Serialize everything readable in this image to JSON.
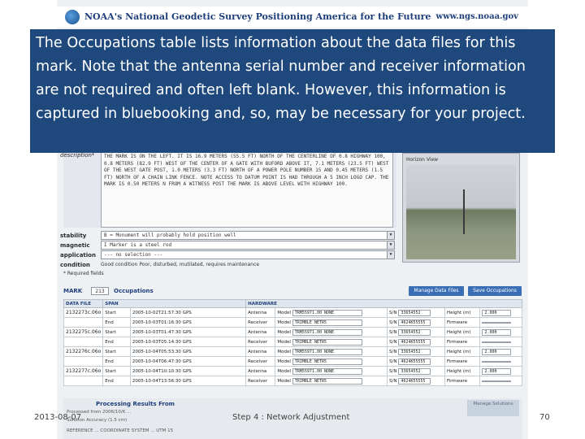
{
  "header": {
    "org_title": "NOAA's National Geodetic Survey Positioning America for the Future",
    "url": "www.ngs.noaa.gov"
  },
  "callout": {
    "text": "The Occupations table lists information about the data files for this mark. Note that the antenna serial number and receiver information are not required and often left blank. However, this information is captured in bluebooking and, so, may be necessary for your project."
  },
  "mark_form": {
    "description_label": "description*",
    "description_text": "THE MARK IS ON THE LEFT. IT IS 16.9 METERS (55.5 FT) NORTH OF THE CENTERLINE OF 0.8 HIGHWAY 100, 0.8 METERS (82.9 FT) WEST OF THE CENTER OF A GATE WITH BUFORD ABOVE IT, 7.1 METERS (23.5 FT) WEST OF THE WEST GATE POST, 1.0 METERS (3.3 FT) NORTH OF A POWER POLE NUMBER 15 AND 0.45 METERS (1.5 FT) NORTH OF A CHAIN LINK FENCE. NOTE ACCESS TO DATUM POINT IS HAD THROUGH A 5 INCH LOGO CAP. THE MARK IS 0.50 METERS N FROM A WITNESS POST THE MARK IS ABOVE LEVEL WITH HIGHWAY 100.",
    "horizon_view_label": "Horizon View",
    "stability_label": "stability",
    "stability_value": "B = Monument will probably hold position well",
    "magnetic_label": "magnetic",
    "magnetic_value": "I   Marker is a steel rod",
    "application_label": "application",
    "application_value": "--- no selection ---",
    "condition_label": "condition",
    "condition_value": "Good condition   Poor, disturbed, mutilated, requires maintenance",
    "required_note": "* Required fields"
  },
  "occupations": {
    "mark_label": "MARK",
    "mark_select": "213",
    "title": "Occupations",
    "manage_button": "Manage Data Files",
    "save_button": "Save Occupations",
    "columns": [
      "DATA FILE",
      "SPAN",
      "HARDWARE"
    ],
    "rows": [
      {
        "file": "2132273c.06o",
        "span_label": "Start",
        "span": "2005-10-02T21:57:30 GPS",
        "hw": "Antenna",
        "model": "TRM55971.00  NONE",
        "sn": "33654552",
        "field": "Height (m)",
        "fval": "2.000",
        "yellow": false
      },
      {
        "file": "",
        "span_label": "End",
        "span": "2005-10-03T01:16:30 GPS",
        "hw": "Receiver",
        "model": "TRIMBLE NETR5",
        "sn": "4624K55555",
        "field": "Firmware",
        "fval": "",
        "yellow": true
      },
      {
        "file": "2132275c.06o",
        "span_label": "Start",
        "span": "2005-10-03T01:47:30 GPS",
        "hw": "Antenna",
        "model": "TRM55971.00  NONE",
        "sn": "33654552",
        "field": "Height (m)",
        "fval": "2.000",
        "yellow": false
      },
      {
        "file": "",
        "span_label": "End",
        "span": "2005-10-03T05:14:30 GPS",
        "hw": "Receiver",
        "model": "TRIMBLE NETR5",
        "sn": "4624K55555",
        "field": "Firmware",
        "fval": "",
        "yellow": true
      },
      {
        "file": "2132276c.06o",
        "span_label": "Start",
        "span": "2005-10-04T05:53:30 GPS",
        "hw": "Antenna",
        "model": "TRM55971.00  NONE",
        "sn": "33654552",
        "field": "Height (m)",
        "fval": "2.000",
        "yellow": false
      },
      {
        "file": "",
        "span_label": "End",
        "span": "2005-10-04T06:47:30 GPS",
        "hw": "Receiver",
        "model": "TRIMBLE NETR5",
        "sn": "4624K55555",
        "field": "Firmware",
        "fval": "",
        "yellow": true
      },
      {
        "file": "2132277c.06o",
        "span_label": "Start",
        "span": "2005-10-04T10:10:30 GPS",
        "hw": "Antenna",
        "model": "TRM55971.00  NONE",
        "sn": "33654552",
        "field": "Height (m)",
        "fval": "2.000",
        "yellow": false
      },
      {
        "file": "",
        "span_label": "End",
        "span": "2005-10-04T13:56:30 GPS",
        "hw": "Receiver",
        "model": "TRIMBLE NETR5",
        "sn": "4624K55555",
        "field": "Firmware",
        "fval": "",
        "yellow": true
      }
    ],
    "model_label": "Model",
    "sn_label": "S/N"
  },
  "processing": {
    "title": "Processing Results From",
    "manage_button": "Manage Solutions",
    "line1": "Processed from 2006/10/6 ...",
    "line2": "Solution Accuracy (1.5 cm)",
    "line3": "REFERENCE   ...   COORDINATE SYSTEM   ...   UTM 15"
  },
  "footer": {
    "date": "2013-08-07",
    "title": "Step 4 : Network Adjustment",
    "page": "70"
  }
}
